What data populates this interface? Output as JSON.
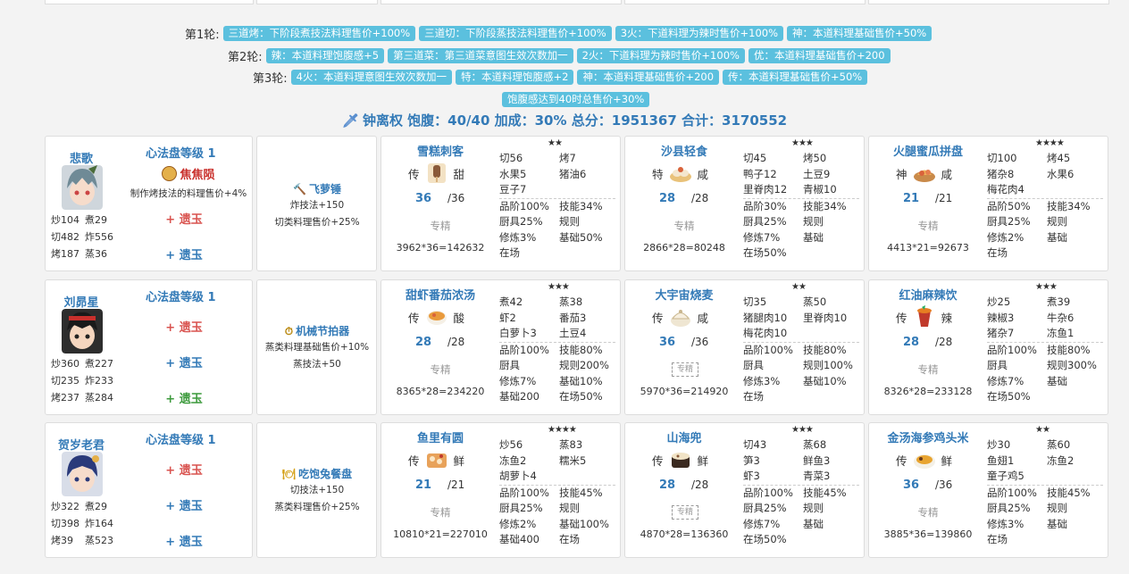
{
  "rounds": [
    {
      "label": "第1轮:",
      "tags": [
        "三道烤：下阶段煮技法料理售价+100%",
        "三道切：下阶段蒸技法料理售价+100%",
        "3火：下道料理为辣时售价+100%",
        "神：本道料理基础售价+50%"
      ]
    },
    {
      "label": "第2轮:",
      "tags": [
        "辣：本道料理饱腹感+5",
        "第三道菜：第三道菜意图生效次数加一",
        "2火：下道料理为辣时售价+100%",
        "优：本道料理基础售价+200"
      ]
    },
    {
      "label": "第3轮:",
      "tags": [
        "4火：本道料理意图生效次数加一",
        "特：本道料理饱腹感+2",
        "神：本道料理基础售价+200",
        "传：本道料理基础售价+50%"
      ]
    },
    {
      "label": "",
      "tags": [
        "饱腹感达到40时总售价+30%"
      ]
    }
  ],
  "summary": {
    "icon": "sword-icon",
    "text": "钟离权 饱腹：40/40 加成：30% 总分：1951367 合计：3170552"
  },
  "rows": [
    {
      "chef": {
        "name": "悲歌",
        "level": "心法盘等级 1",
        "skill_name": "焦焦陨",
        "skill_desc": "制作烤技法的料理售价+4%",
        "stats": [
          [
            "炒104",
            "煮29"
          ],
          [
            "切482",
            "炸556"
          ],
          [
            "烤187",
            "蒸36"
          ]
        ],
        "jades": [
          {
            "text": "+ 遗玉",
            "color": "red"
          },
          {
            "text": "+ 遗玉",
            "color": "blue"
          }
        ]
      },
      "equip": {
        "name": "飞萝锤",
        "desc": [
          "炸技法+150",
          "切类料理售价+25%"
        ]
      },
      "dishes": [
        {
          "name": "雪糕刺客",
          "stars": "★★",
          "rarity": "传",
          "taste": "甜",
          "qty": "36",
          "max": "/36",
          "spec": "专精",
          "calc": "3962*36=142632",
          "skills": [
            [
              "切56",
              "烤7"
            ],
            [
              "水果5",
              "猪油6"
            ],
            [
              "豆子7",
              ""
            ]
          ],
          "bonus": [
            [
              "品阶100%",
              "技能34%"
            ],
            [
              "厨具25%",
              "规则"
            ],
            [
              "修炼3%",
              "基础50%"
            ],
            [
              "在场",
              ""
            ]
          ]
        },
        {
          "name": "沙县轻食",
          "stars": "★★★",
          "rarity": "特",
          "taste": "咸",
          "qty": "28",
          "max": "/28",
          "spec": "专精",
          "calc": "2866*28=80248",
          "skills": [
            [
              "切45",
              "烤50"
            ],
            [
              "鸭子12",
              "土豆9"
            ],
            [
              "里脊肉12",
              "青椒10"
            ]
          ],
          "bonus": [
            [
              "品阶30%",
              "技能34%"
            ],
            [
              "厨具25%",
              "规则"
            ],
            [
              "修炼7%",
              "基础"
            ],
            [
              "在场50%",
              ""
            ]
          ]
        },
        {
          "name": "火腿蜜瓜拼盘",
          "stars": "★★★★",
          "rarity": "神",
          "taste": "咸",
          "qty": "21",
          "max": "/21",
          "spec": "专精",
          "calc": "4413*21=92673",
          "skills": [
            [
              "切100",
              "烤45"
            ],
            [
              "猪杂8",
              "水果6"
            ],
            [
              "梅花肉4",
              ""
            ]
          ],
          "bonus": [
            [
              "品阶50%",
              "技能34%"
            ],
            [
              "厨具25%",
              "规则"
            ],
            [
              "修炼2%",
              "基础"
            ],
            [
              "在场",
              ""
            ]
          ]
        }
      ]
    },
    {
      "chef": {
        "name": "刘昴星",
        "level": "心法盘等级 1",
        "skill_name": "",
        "skill_desc": "",
        "stats": [
          [
            "炒360",
            "煮227"
          ],
          [
            "切235",
            "炸233"
          ],
          [
            "烤237",
            "蒸284"
          ]
        ],
        "jades": [
          {
            "text": "+ 遗玉",
            "color": "red"
          },
          {
            "text": "+ 遗玉",
            "color": "blue"
          },
          {
            "text": "+ 遗玉",
            "color": "green"
          }
        ]
      },
      "equip": {
        "name": "机械节拍器",
        "desc": [
          "蒸类料理基础售价+10%",
          "蒸技法+50"
        ]
      },
      "dishes": [
        {
          "name": "甜虾番茄浓汤",
          "stars": "★★★",
          "rarity": "传",
          "taste": "酸",
          "qty": "28",
          "max": "/28",
          "spec": "专精",
          "calc": "8365*28=234220",
          "skills": [
            [
              "煮42",
              "蒸38"
            ],
            [
              "虾2",
              "番茄3"
            ],
            [
              "白萝卜3",
              "土豆4"
            ]
          ],
          "bonus": [
            [
              "品阶100%",
              "技能80%"
            ],
            [
              "厨具",
              "规则200%"
            ],
            [
              "修炼7%",
              "基础10%"
            ],
            [
              "基础200",
              "在场50%"
            ]
          ]
        },
        {
          "name": "大宇宙烧麦",
          "stars": "★★",
          "rarity": "传",
          "taste": "咸",
          "qty": "36",
          "max": "/36",
          "spec": "专精",
          "calc": "5970*36=214920",
          "skills": [
            [
              "切35",
              "蒸50"
            ],
            [
              "猪腿肉10",
              "里脊肉10"
            ],
            [
              "梅花肉10",
              ""
            ]
          ],
          "bonus": [
            [
              "品阶100%",
              "技能80%"
            ],
            [
              "厨具",
              "规则100%"
            ],
            [
              "修炼3%",
              "基础10%"
            ],
            [
              "在场",
              ""
            ]
          ]
        },
        {
          "name": "红油麻辣饮",
          "stars": "★★★",
          "rarity": "传",
          "taste": "辣",
          "qty": "28",
          "max": "/28",
          "spec": "专精",
          "calc": "8326*28=233128",
          "skills": [
            [
              "炒25",
              "煮39"
            ],
            [
              "辣椒3",
              "牛杂6"
            ],
            [
              "猪杂7",
              "冻鱼1"
            ]
          ],
          "bonus": [
            [
              "品阶100%",
              "技能80%"
            ],
            [
              "厨具",
              "规则300%"
            ],
            [
              "修炼7%",
              "基础"
            ],
            [
              "在场50%",
              ""
            ]
          ]
        }
      ]
    },
    {
      "chef": {
        "name": "贺岁老君",
        "level": "心法盘等级 1",
        "skill_name": "",
        "skill_desc": "",
        "stats": [
          [
            "炒322",
            "煮29"
          ],
          [
            "切398",
            "炸164"
          ],
          [
            "烤39",
            "蒸523"
          ]
        ],
        "jades": [
          {
            "text": "+ 遗玉",
            "color": "red"
          },
          {
            "text": "+ 遗玉",
            "color": "blue"
          },
          {
            "text": "+ 遗玉",
            "color": "blue"
          }
        ]
      },
      "equip": {
        "name": "吃饱兔餐盘",
        "desc": [
          "切技法+150",
          "蒸类料理售价+25%"
        ]
      },
      "dishes": [
        {
          "name": "鱼里有圆",
          "stars": "★★★★",
          "rarity": "传",
          "taste": "鲜",
          "qty": "21",
          "max": "/21",
          "spec": "专精",
          "calc": "10810*21=227010",
          "skills": [
            [
              "炒56",
              "蒸83"
            ],
            [
              "冻鱼2",
              "糯米5"
            ],
            [
              "胡萝卜4",
              ""
            ]
          ],
          "bonus": [
            [
              "品阶100%",
              "技能45%"
            ],
            [
              "厨具25%",
              "规则"
            ],
            [
              "修炼2%",
              "基础100%"
            ],
            [
              "基础400",
              "在场"
            ]
          ]
        },
        {
          "name": "山海兜",
          "stars": "★★★",
          "rarity": "传",
          "taste": "鲜",
          "qty": "28",
          "max": "/28",
          "spec": "专精",
          "calc": "4870*28=136360",
          "skills": [
            [
              "切43",
              "蒸68"
            ],
            [
              "笋3",
              "鲜鱼3"
            ],
            [
              "虾3",
              "青菜3"
            ]
          ],
          "bonus": [
            [
              "品阶100%",
              "技能45%"
            ],
            [
              "厨具25%",
              "规则"
            ],
            [
              "修炼7%",
              "基础"
            ],
            [
              "在场50%",
              ""
            ]
          ]
        },
        {
          "name": "金汤海参鸡头米",
          "stars": "★★",
          "rarity": "传",
          "taste": "鲜",
          "qty": "36",
          "max": "/36",
          "spec": "专精",
          "calc": "3885*36=139860",
          "skills": [
            [
              "炒30",
              "蒸60"
            ],
            [
              "鱼翅1",
              "冻鱼2"
            ],
            [
              "童子鸡5",
              ""
            ]
          ],
          "bonus": [
            [
              "品阶100%",
              "技能45%"
            ],
            [
              "厨具25%",
              "规则"
            ],
            [
              "修炼3%",
              "基础"
            ],
            [
              "在场",
              ""
            ]
          ]
        }
      ]
    }
  ]
}
